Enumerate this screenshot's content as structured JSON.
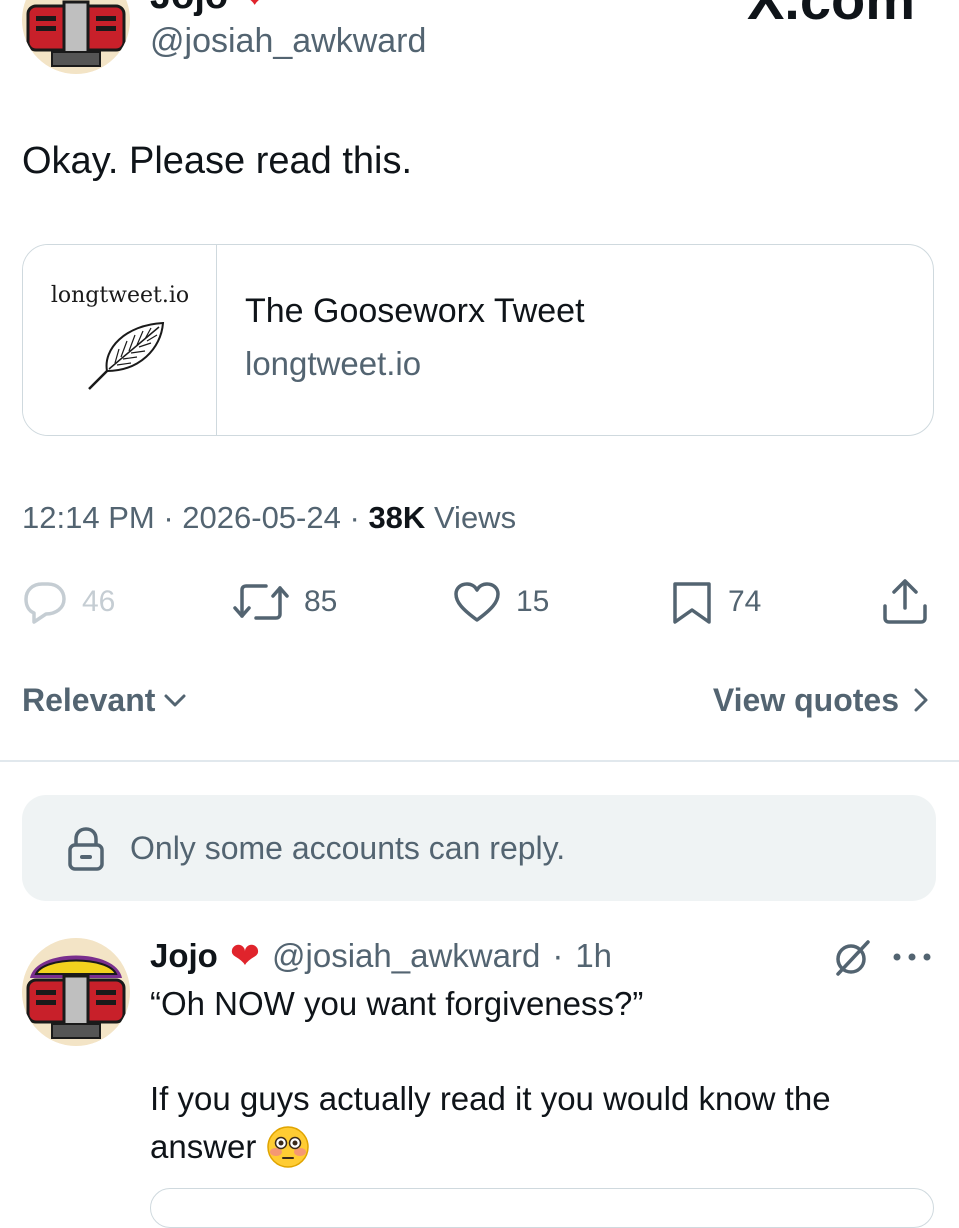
{
  "header": {
    "display_name": "Jojo",
    "handle": "@josiah_awkward",
    "brand": "X.com"
  },
  "tweet": {
    "text": "Okay. Please read this.",
    "card": {
      "thumbnail_label": "longtweet.io",
      "title": "The Gooseworx Tweet",
      "domain": "longtweet.io"
    },
    "time": "12:14 PM",
    "date": "2026-05-24",
    "views_count": "38K",
    "views_label": "Views",
    "separator": "·"
  },
  "actions": {
    "replies": "46",
    "retweets": "85",
    "likes": "15",
    "bookmarks": "74"
  },
  "conversation": {
    "sort_label": "Relevant",
    "view_quotes_label": "View quotes",
    "reply_restriction": "Only some accounts can reply."
  },
  "reply": {
    "display_name": "Jojo",
    "handle": "@josiah_awkward",
    "time": "1h",
    "line1": "“Oh NOW you want forgiveness?”",
    "line2": "If you guys actually read it you would know the",
    "line3": "answer"
  },
  "colors": {
    "text_primary": "#0f1419",
    "text_secondary": "#536471",
    "border": "#cfd9de",
    "heart": "#e0242c",
    "banner_bg": "#eff3f4"
  },
  "icons": {
    "heart": "heart-emoji-icon",
    "reply": "reply-icon",
    "retweet": "retweet-icon",
    "like": "like-icon",
    "bookmark": "bookmark-icon",
    "share": "share-icon",
    "lock": "lock-icon",
    "grok": "grok-icon",
    "more": "more-icon",
    "flushed": "flushed-face-icon",
    "feather": "feather-icon"
  }
}
